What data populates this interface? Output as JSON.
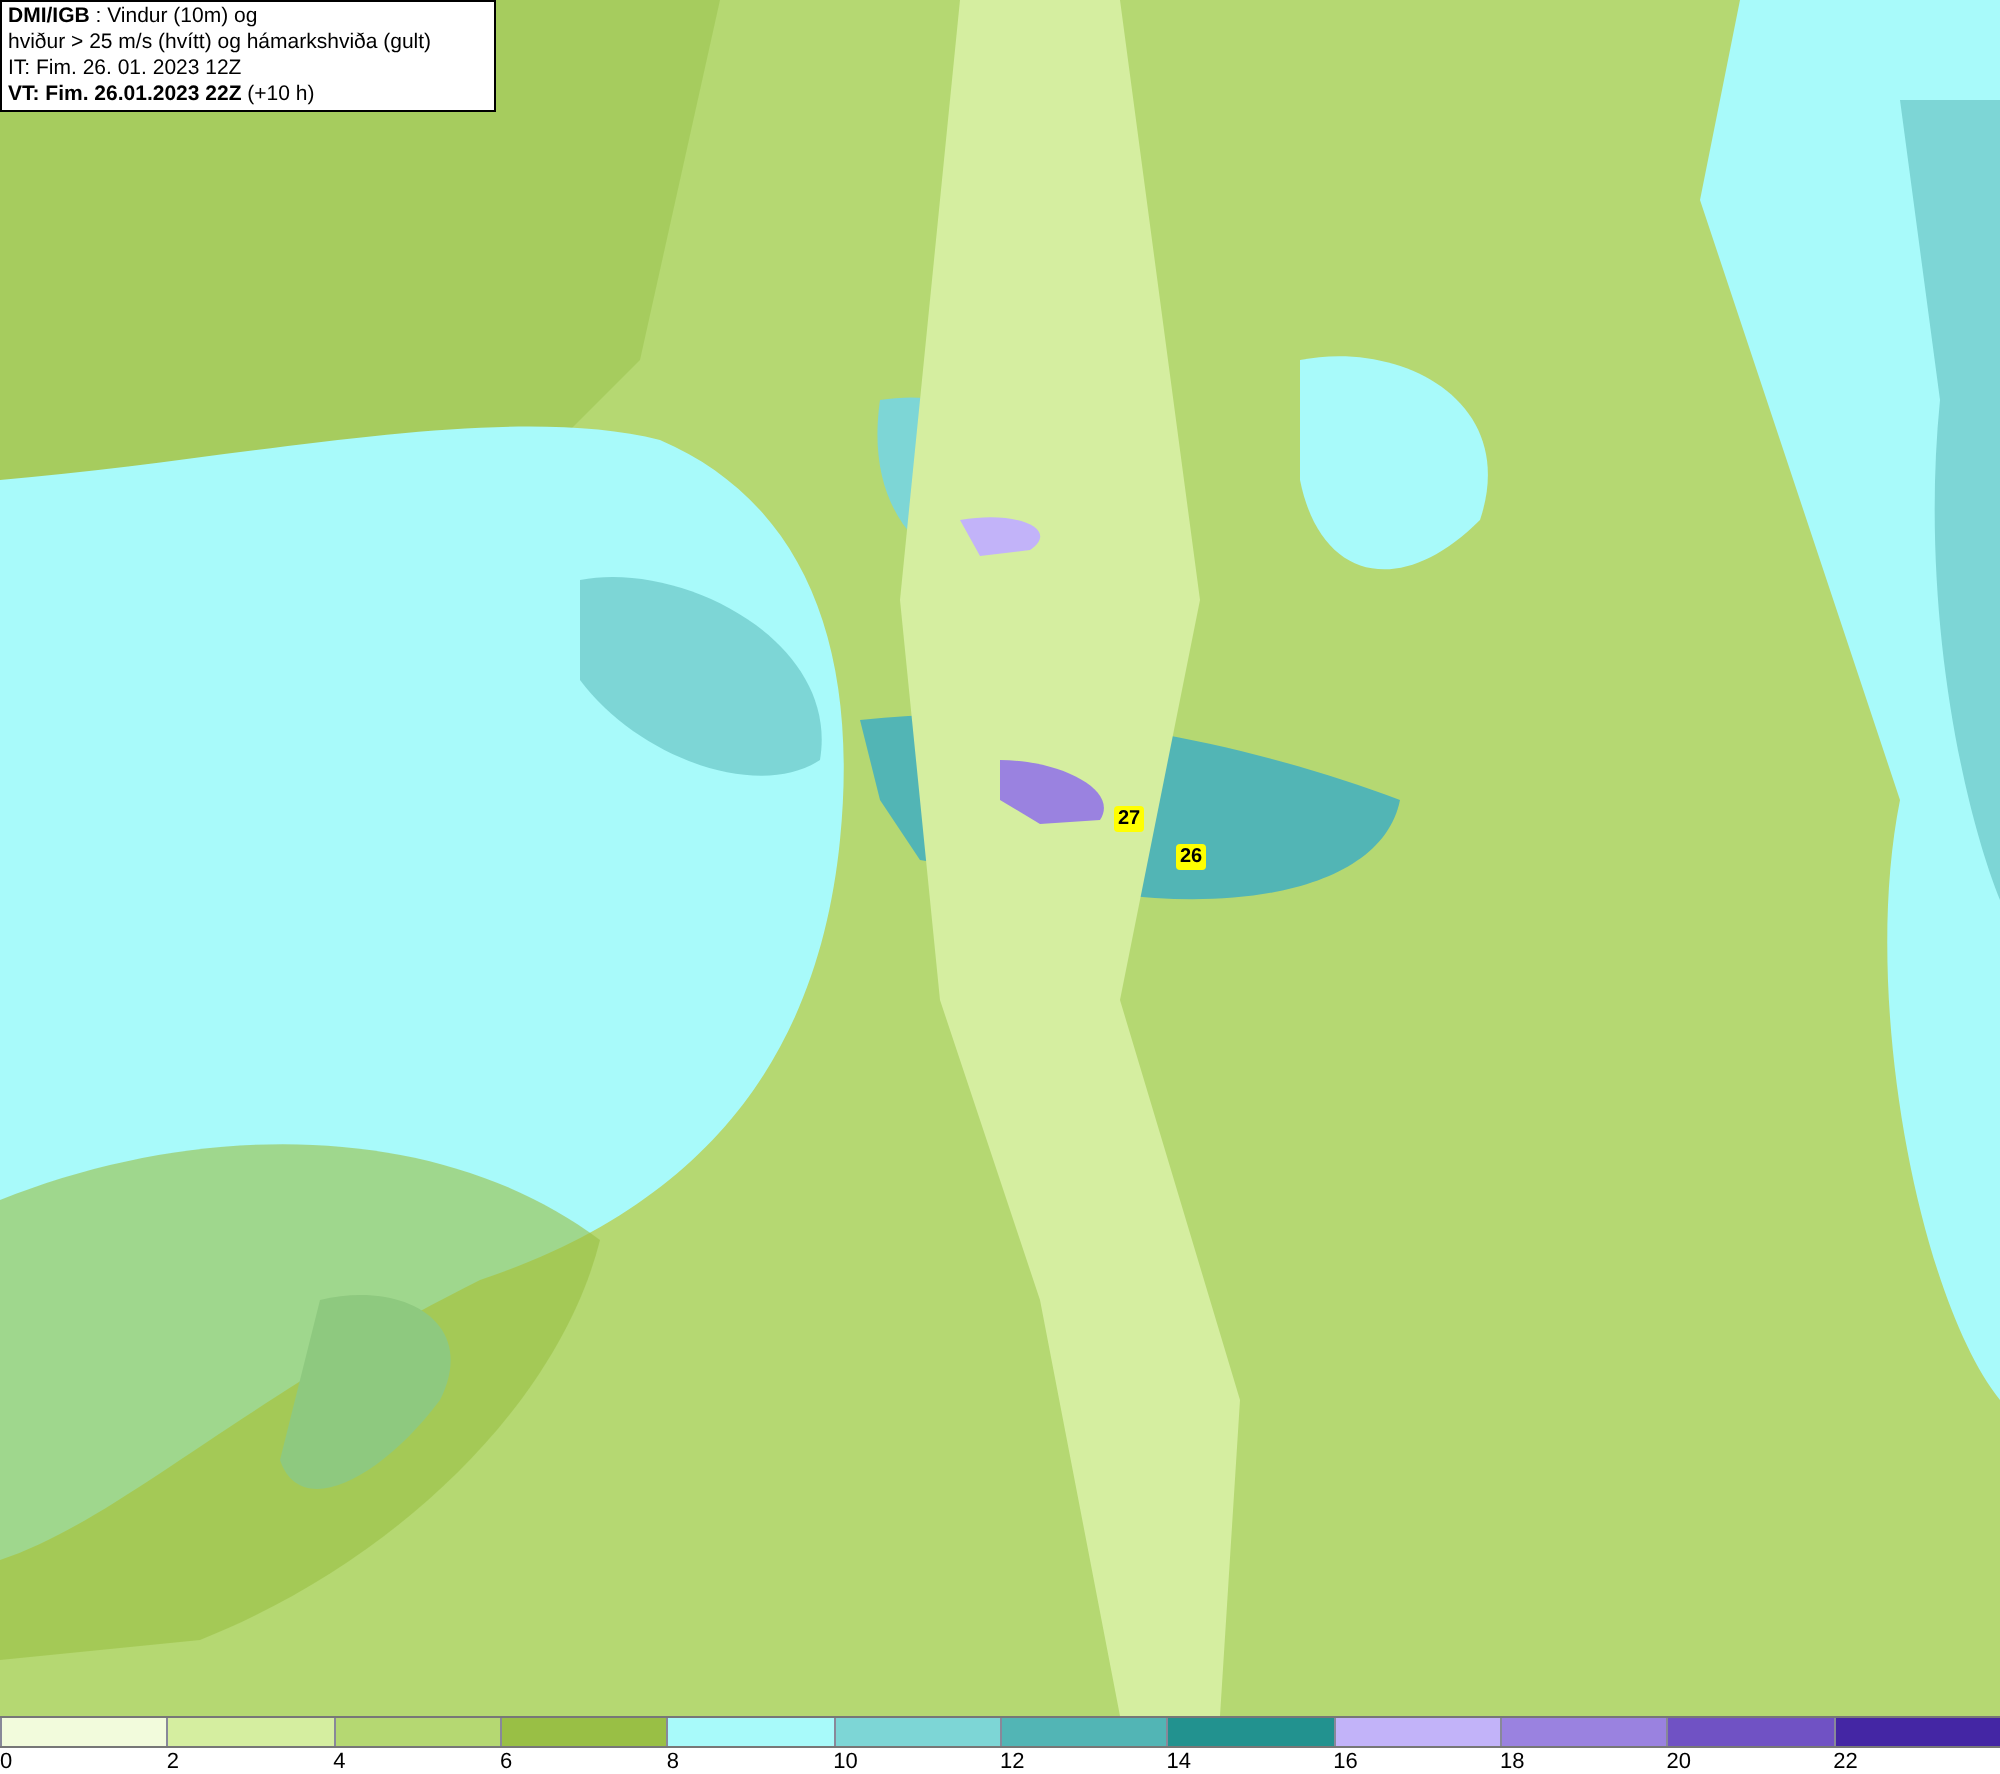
{
  "header": {
    "lines": [
      "**DMI/IGB** : Vindur (10m) og",
      "hviður > 25 m/s (hvítt) og hámarkshviða (gult)",
      "IT: Fim. 26. 01. 2023 12Z",
      "**VT: Fim. 26.01.2023 22Z** (+10 h)"
    ]
  },
  "map": {
    "gust_labels": [
      "27",
      "26"
    ]
  },
  "legend": {
    "bins": [
      {
        "color": "#f2fbdc"
      },
      {
        "color": "#d5eea0"
      },
      {
        "color": "#b5d872"
      },
      {
        "color": "#99bf45"
      },
      {
        "color": "#a8fafa"
      },
      {
        "color": "#7dd6d6"
      },
      {
        "color": "#52b5b5"
      },
      {
        "color": "#22928f"
      },
      {
        "color": "#c2b3f9"
      },
      {
        "color": "#9a82e0"
      },
      {
        "color": "#7052c4"
      },
      {
        "color": "#4426a4"
      }
    ],
    "ticks": [
      "0",
      "2",
      "4",
      "6",
      "8",
      "10",
      "12",
      "14",
      "16",
      "18",
      "20",
      "22"
    ]
  }
}
